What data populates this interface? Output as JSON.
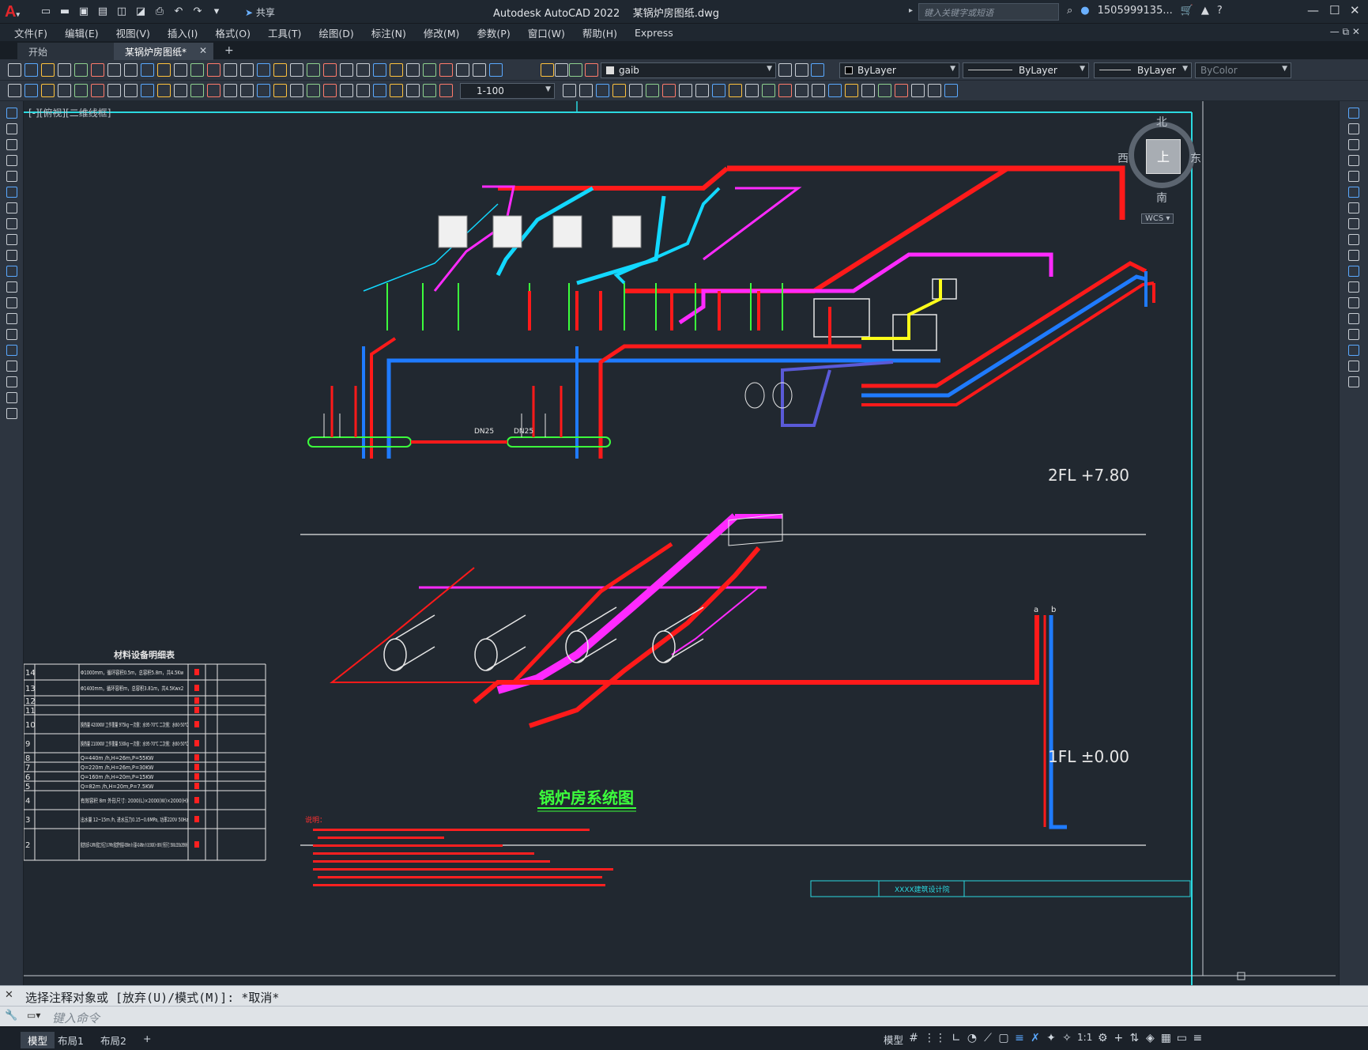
{
  "app": {
    "name": "Autodesk AutoCAD 2022",
    "file": "某锅炉房图纸.dwg",
    "share": "共享"
  },
  "search": {
    "placeholder": "键入关键字或短语"
  },
  "user": {
    "account": "1505999135..."
  },
  "menu": [
    "文件(F)",
    "编辑(E)",
    "视图(V)",
    "插入(I)",
    "格式(O)",
    "工具(T)",
    "绘图(D)",
    "标注(N)",
    "修改(M)",
    "参数(P)",
    "窗口(W)",
    "帮助(H)",
    "Express"
  ],
  "tabs": {
    "start": "开始",
    "active": "某锅炉房图纸*"
  },
  "props": {
    "layer": "gaib",
    "color": "ByLayer",
    "linetype": "ByLayer",
    "lineweight": "ByLayer",
    "plotstyle": "ByColor",
    "scale": "1-100"
  },
  "view": {
    "label": "[-][俯视][二维线框]"
  },
  "viewcube": {
    "north": "北",
    "south": "南",
    "east": "东",
    "west": "西",
    "face": "上",
    "wcs": "WCS"
  },
  "drawing": {
    "floor2": "2FL  +7.80",
    "floor1": "1FL  ±0.00",
    "title": "锅炉房系统图",
    "dn1": "DN25",
    "dn2": "DN25",
    "pipe_a": "a",
    "pipe_b": "b",
    "notes_head": "说明：",
    "title_block": "XXXX建筑设计院"
  },
  "table": {
    "title": "材料设备明细表",
    "rows": [
      {
        "no": "14",
        "spec": "Φ1000mm，循环容积0.5m，总容积5.8m，共4.5Kw"
      },
      {
        "no": "13",
        "spec": "Φ1400mm，循环容积m，总容积3.81m，共4.5Kwx2"
      },
      {
        "no": "12",
        "spec": ""
      },
      {
        "no": "11",
        "spec": ""
      },
      {
        "no": "10",
        "spec": "换热量 4200KW 工作重量 975kg 一次侧：水95-70℃ 二次侧：水60-50℃"
      },
      {
        "no": "9",
        "spec": "换热量 2100KW 工作重量 530kg 一次侧：水95-70℃ 二次侧：水60-50℃"
      },
      {
        "no": "8",
        "spec": "Q=440m /h,H=26m,P=55KW"
      },
      {
        "no": "7",
        "spec": "Q=220m /h,H=26m,P=30KW"
      },
      {
        "no": "6",
        "spec": "Q=160m /h,H=20m,P=15KW"
      },
      {
        "no": "5",
        "spec": "Q=82m /h,H=20m,P=7.5KW"
      },
      {
        "no": "4",
        "spec": "有效容积 8m 外形尺寸: 2000(L)×2000(W)×2000(H)"
      },
      {
        "no": "3",
        "spec": "出水量 12~15m /h, 进水压力0.15~0.6MPa, 功率220V 50Hz"
      },
      {
        "no": "2",
        "spec": "额定热功率 4.2MW 额定工作压力 0.7MPa 额定燃气耗量 456Nm /h 风量 4148Nm /h 18.5KW(3~380V) 外形尺寸: 5600x2393x2898(H)"
      }
    ]
  },
  "command": {
    "history": "选择注释对象或 [放弃(U)/模式(M)]: *取消*",
    "placeholder": "键入命令"
  },
  "status": {
    "tabs": [
      "模型",
      "布局1",
      "布局2"
    ],
    "mode": "模型",
    "scale": "1:1"
  }
}
